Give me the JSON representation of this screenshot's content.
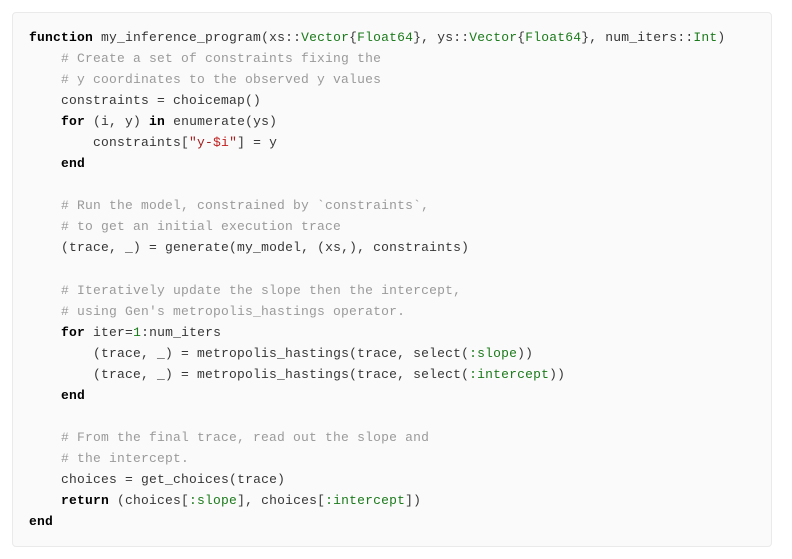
{
  "code": {
    "k_function": "function",
    "fn_name": "my_inference_program",
    "sig_open": "(",
    "p1_name": "xs",
    "dcolon": "::",
    "t_vec": "Vector",
    "t_open": "{",
    "t_f64": "Float64",
    "t_close": "}",
    "comma": ", ",
    "p2_name": "ys",
    "p3_name": "num_iters",
    "t_int": "Int",
    "sig_close": ")",
    "c1": "# Create a set of constraints fixing the",
    "c2": "# y coordinates to the observed y values",
    "l3_lhs": "constraints ",
    "eq": "=",
    "l3_rhs": " choicemap()",
    "k_for": "for",
    "for1_iter": " (i, y) ",
    "k_in": "in",
    "for1_seq": " enumerate(ys)",
    "l5_a": "constraints[",
    "l5_str1": "\"y-",
    "l5_interp": "$i",
    "l5_str2": "\"",
    "l5_b": "] ",
    "l5_c": " y",
    "k_end": "end",
    "c3": "# Run the model, constrained by `constraints`,",
    "c4": "# to get an initial execution trace",
    "l8_a": "(trace, _) ",
    "l8_b": " generate(my_model, (xs,), constraints)",
    "c5": "# Iteratively update the slope then the intercept,",
    "c6": "# using Gen's metropolis_hastings operator.",
    "for2_iter": " iter",
    "for2_eq": "=",
    "n1": "1",
    "colon": ":",
    "for2_end": "num_iters",
    "l11_a": "(trace, _) ",
    "l11_b": " metropolis_hastings(trace, select(",
    "sym_slope": ":slope",
    "l11_c": "))",
    "l12_a": "(trace, _) ",
    "l12_b": " metropolis_hastings(trace, select(",
    "sym_int": ":intercept",
    "l12_c": "))",
    "c7": "# From the final trace, read out the slope and",
    "c8": "# the intercept.",
    "l14_a": "choices ",
    "l14_b": " get_choices(trace)",
    "k_return": "return",
    "l15_a": " (choices[",
    "l15_b": "], choices[",
    "l15_c": "])"
  }
}
